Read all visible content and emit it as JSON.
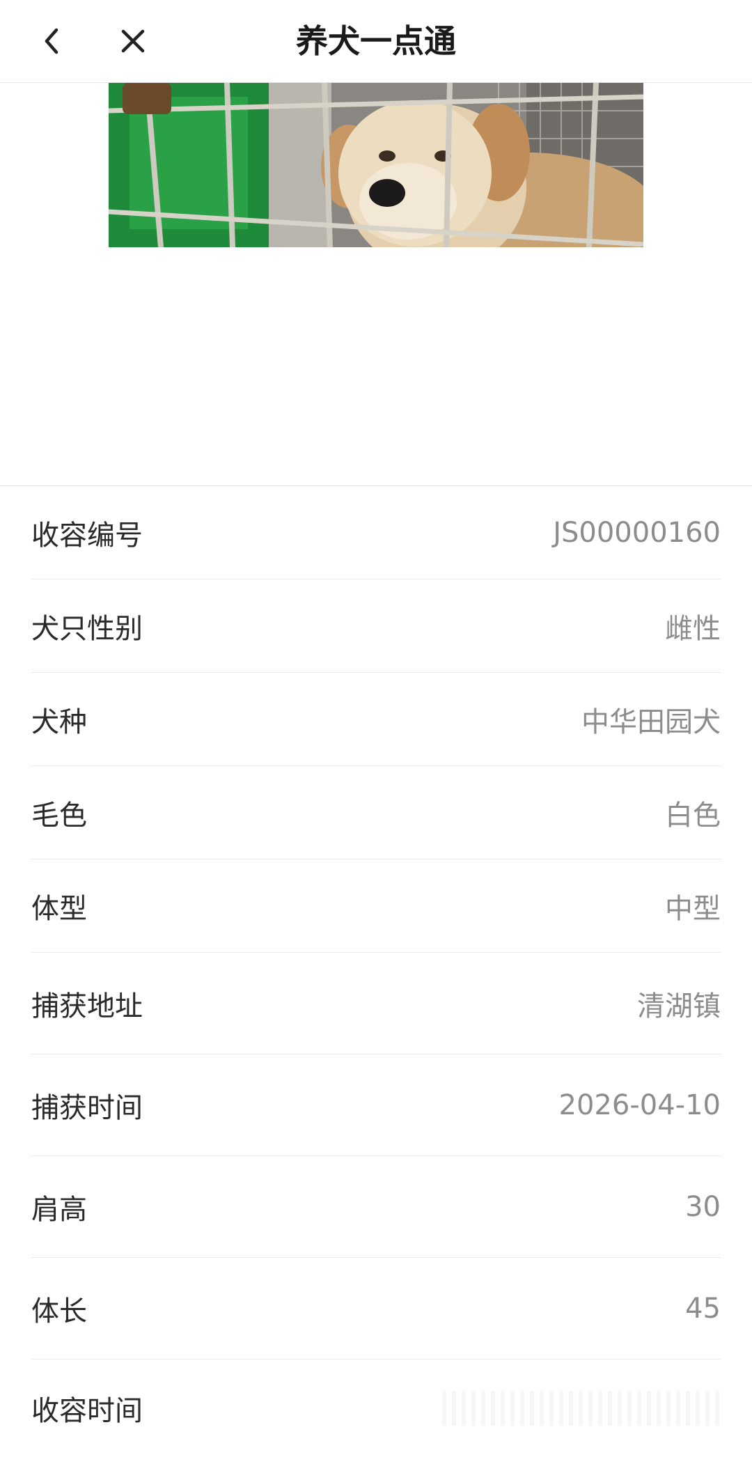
{
  "header": {
    "title": "养犬一点通",
    "back_icon": "chevron-left-icon",
    "close_icon": "close-icon"
  },
  "photo": {
    "subject": "dog-in-cage-photo"
  },
  "details": [
    {
      "label": "收容编号",
      "value": "JS00000160"
    },
    {
      "label": "犬只性别",
      "value": "雌性"
    },
    {
      "label": "犬种",
      "value": "中华田园犬"
    },
    {
      "label": "毛色",
      "value": "白色"
    },
    {
      "label": "体型",
      "value": "中型"
    },
    {
      "label": "捕获地址",
      "value": "清湖镇"
    },
    {
      "label": "捕获时间",
      "value": "2026-04-10"
    },
    {
      "label": "肩高",
      "value": "30"
    },
    {
      "label": "体长",
      "value": "45"
    },
    {
      "label": "收容时间",
      "value": ""
    }
  ]
}
